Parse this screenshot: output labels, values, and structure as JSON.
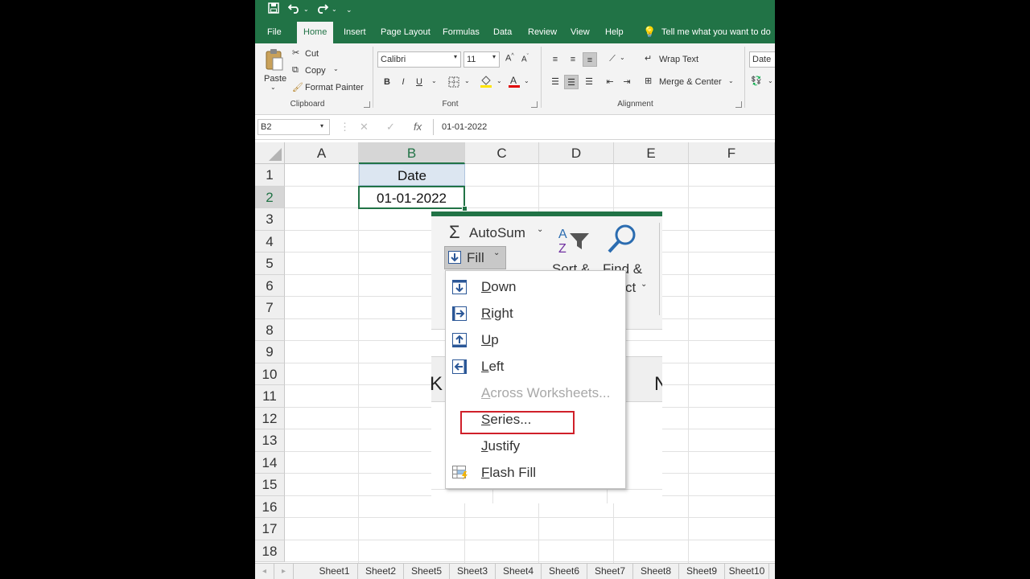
{
  "ribbon_tabs": [
    "File",
    "Home",
    "Insert",
    "Page Layout",
    "Formulas",
    "Data",
    "Review",
    "View",
    "Help"
  ],
  "tell_me": "Tell me what you want to do",
  "clipboard": {
    "paste": "Paste",
    "cut": "Cut",
    "copy": "Copy",
    "format_painter": "Format Painter",
    "group": "Clipboard"
  },
  "font": {
    "name": "Calibri",
    "size": "11",
    "group": "Font",
    "bold": "B",
    "italic": "I",
    "underline": "U"
  },
  "alignment": {
    "wrap": "Wrap Text",
    "merge": "Merge & Center",
    "group": "Alignment"
  },
  "number": {
    "format": "Date"
  },
  "formula_bar": {
    "name_box": "B2",
    "fx": "fx",
    "value": "01-01-2022"
  },
  "columns": [
    "A",
    "B",
    "C",
    "D",
    "E",
    "F"
  ],
  "rows": [
    "1",
    "2",
    "3",
    "4",
    "5",
    "6",
    "7",
    "8",
    "9",
    "10",
    "11",
    "12",
    "13",
    "14",
    "15",
    "16",
    "17",
    "18"
  ],
  "cells": {
    "B1": "Date",
    "B2": "01-01-2022"
  },
  "sheets": [
    "Sheet1",
    "Sheet2",
    "Sheet5",
    "Sheet3",
    "Sheet4",
    "Sheet6",
    "Sheet7",
    "Sheet8",
    "Sheet9",
    "Sheet10"
  ],
  "editing": {
    "autosum": "AutoSum",
    "fill": "Fill",
    "sort": "Sort &",
    "find": "Find &",
    "select_fragment": "ct",
    "grid_fragment_left": "K",
    "grid_fragment_right": "N"
  },
  "fill_menu": [
    {
      "mnemonic": "D",
      "rest": "own",
      "enabled": true,
      "icon": "fill-down-icon"
    },
    {
      "mnemonic": "R",
      "rest": "ight",
      "enabled": true,
      "icon": "fill-right-icon"
    },
    {
      "mnemonic": "U",
      "rest": "p",
      "enabled": true,
      "icon": "fill-up-icon"
    },
    {
      "mnemonic": "L",
      "rest": "eft",
      "enabled": true,
      "icon": "fill-left-icon"
    },
    {
      "mnemonic": "A",
      "rest": "cross Worksheets...",
      "enabled": false,
      "icon": ""
    },
    {
      "mnemonic": "S",
      "rest": "eries...",
      "enabled": true,
      "icon": ""
    },
    {
      "mnemonic": "J",
      "rest": "ustify",
      "enabled": true,
      "icon": ""
    },
    {
      "mnemonic": "F",
      "rest": "lash Fill",
      "enabled": true,
      "icon": "flash-fill-icon"
    }
  ],
  "colors": {
    "excel_green": "#217346",
    "highlight": "#d0202a",
    "selected_header": "#d6d6d6"
  }
}
